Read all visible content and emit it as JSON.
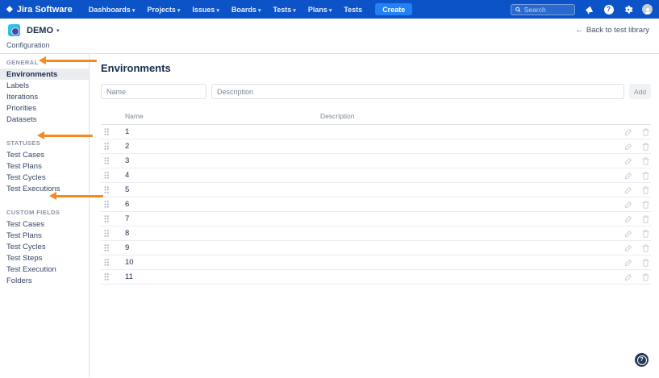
{
  "colors": {
    "navbar_bg": "#0B53C6",
    "create_button": "#2380F5",
    "arrow_orange": "#F6891F",
    "selected_item_bg": "#EBECF0",
    "title_text": "#172B4D",
    "help_button_bg": "#253858"
  },
  "navbar": {
    "logo": "Jira Software",
    "logo_icon": "jira-diamond-icon",
    "menus": [
      {
        "label": "Dashboards",
        "caret": "▾"
      },
      {
        "label": "Projects",
        "caret": "▾"
      },
      {
        "label": "Issues",
        "caret": "▾"
      },
      {
        "label": "Boards",
        "caret": "▾"
      },
      {
        "label": "Tests",
        "caret": "▾"
      },
      {
        "label": "Plans",
        "caret": "▾"
      },
      {
        "label": "Tests",
        "caret": ""
      }
    ],
    "create_label": "Create",
    "search": {
      "placeholder": "Search",
      "icon": "search-icon"
    },
    "right_icons": [
      "megaphone-icon",
      "help-icon",
      "gear-icon",
      "user-avatar"
    ],
    "help_glyph": "?"
  },
  "header": {
    "project_name": "DEMO",
    "caret": "▾",
    "back_arrow": "←",
    "back_label": "Back to test library"
  },
  "breadcrumb": "Configuration",
  "sidebar": {
    "groups": [
      {
        "heading": "GENERAL",
        "items": [
          {
            "label": "Environments",
            "selected": true
          },
          {
            "label": "Labels"
          },
          {
            "label": "Iterations"
          },
          {
            "label": "Priorities"
          },
          {
            "label": "Datasets"
          }
        ]
      },
      {
        "heading": "STATUSES",
        "items": [
          {
            "label": "Test Cases"
          },
          {
            "label": "Test Plans"
          },
          {
            "label": "Test Cycles"
          },
          {
            "label": "Test Executions"
          }
        ]
      },
      {
        "heading": "CUSTOM FIELDS",
        "items": [
          {
            "label": "Test Cases"
          },
          {
            "label": "Test Plans"
          },
          {
            "label": "Test Cycles"
          },
          {
            "label": "Test Steps"
          },
          {
            "label": "Test Execution"
          },
          {
            "label": "Folders"
          }
        ]
      }
    ]
  },
  "main": {
    "title": "Environments",
    "form": {
      "name_placeholder": "Name",
      "description_placeholder": "Description",
      "add_label": "Add"
    },
    "table": {
      "columns": {
        "name": "Name",
        "description": "Description"
      },
      "rows": [
        {
          "name": "1",
          "description": ""
        },
        {
          "name": "2",
          "description": ""
        },
        {
          "name": "3",
          "description": ""
        },
        {
          "name": "4",
          "description": ""
        },
        {
          "name": "5",
          "description": ""
        },
        {
          "name": "6",
          "description": ""
        },
        {
          "name": "7",
          "description": ""
        },
        {
          "name": "8",
          "description": ""
        },
        {
          "name": "9",
          "description": ""
        },
        {
          "name": "10",
          "description": ""
        },
        {
          "name": "11",
          "description": ""
        }
      ]
    }
  },
  "help_button_glyph": "?"
}
